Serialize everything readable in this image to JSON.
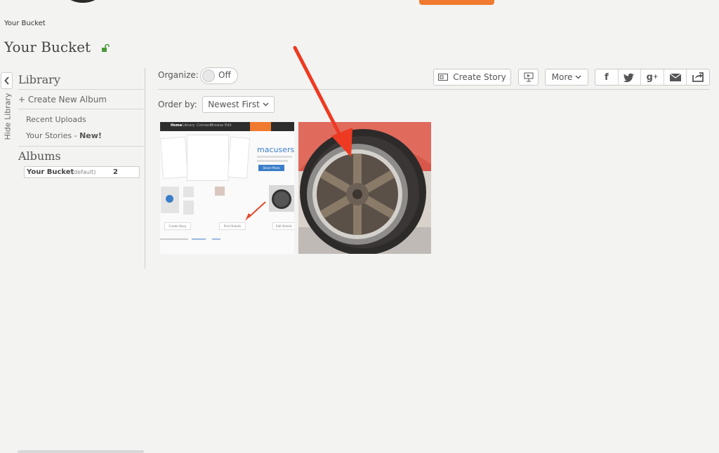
{
  "breadcrumb": "Your Bucket",
  "page_title": "Your Bucket",
  "sidebar": {
    "hide_label": "Hide Library",
    "library_heading": "Library",
    "create_album": "+ Create New Album",
    "recent_uploads": "Recent Uploads",
    "your_stories": "Your Stories",
    "new_badge": "New!",
    "albums_heading": "Albums",
    "album": {
      "name": "Your Bucket",
      "tag": "(default)",
      "count": "2"
    }
  },
  "toolbar": {
    "organize_label": "Organize:",
    "toggle_state": "Off",
    "create_story": "Create Story",
    "more": "More",
    "order_label": "Order by:",
    "order_value": "Newest First"
  },
  "social": [
    "facebook-icon",
    "twitter-icon",
    "google-plus-icon",
    "email-icon",
    "share-icon"
  ],
  "thumbnail1": {
    "nav": [
      "Home",
      "Library",
      "Connect",
      "Browse",
      "Edit"
    ],
    "heading": "macusers",
    "share_button": "Share Photo",
    "buttons": [
      "Create Story",
      "Print Details",
      "Edit Details"
    ]
  },
  "colors": {
    "accent": "#f07a2f",
    "page_bg": "#f3f3f2",
    "green_lock": "#4a9a3a"
  }
}
